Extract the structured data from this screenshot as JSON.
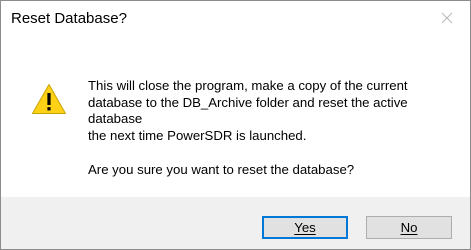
{
  "dialog": {
    "title": "Reset Database?",
    "close_icon": "close-icon",
    "warning_icon": "warning-triangle-icon",
    "message_lines": [
      "This will close the program, make a copy of the current",
      "database to the DB_Archive folder and reset the active",
      "database",
      "the next time PowerSDR is launched."
    ],
    "question": "Are you sure you want to reset the database?",
    "buttons": {
      "yes_label": "Yes",
      "no_label": "No"
    },
    "colors": {
      "warning_yellow": "#fcd116",
      "default_button_border": "#0078d7",
      "footer_background": "#f0f0f0"
    }
  }
}
